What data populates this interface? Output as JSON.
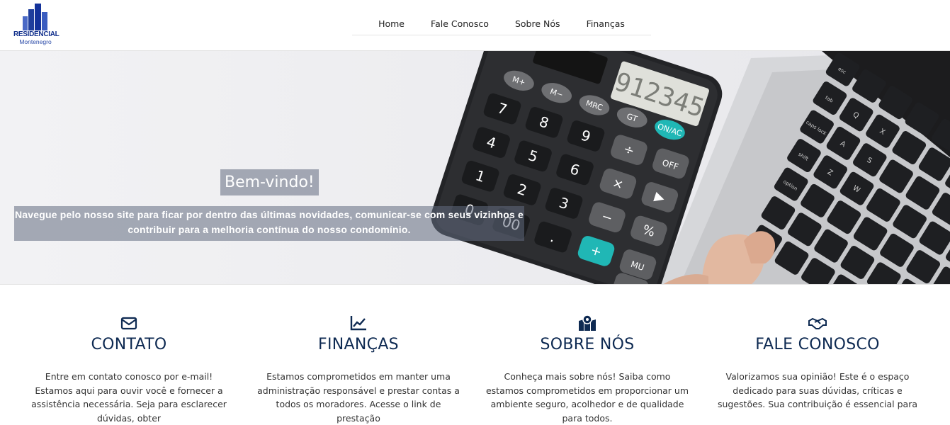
{
  "brand": {
    "name": "RESIDENCIAL",
    "subtitle": "Montenegro",
    "logo_color": "#1f3e9c"
  },
  "nav": {
    "items": [
      {
        "label": "Home"
      },
      {
        "label": "Fale Conosco"
      },
      {
        "label": "Sobre Nós"
      },
      {
        "label": "Finanças"
      }
    ]
  },
  "hero": {
    "title": "Bem-vindo!",
    "text": "Navegue pelo nosso site para ficar por dentro das últimas novidades, comunicar-se com seus vizinhos e contribuir para a melhoria contínua do nosso condomínio.",
    "calculator_display": "912345",
    "calculator_keys": {
      "row1": [
        "M+",
        "M−",
        "MRC",
        "GT",
        "ON/AC"
      ],
      "numbers": [
        "7",
        "8",
        "9",
        "4",
        "5",
        "6",
        "1",
        "2",
        "3",
        "0",
        "00",
        "."
      ],
      "ops": [
        "÷",
        "OFF",
        "×",
        "▶",
        "−",
        "%",
        "MU",
        "+",
        "="
      ]
    },
    "keyboard_keys": [
      "esc",
      "tab",
      "caps lock",
      "shift",
      "option",
      "Q",
      "A",
      "Z",
      "X",
      "S",
      "W"
    ]
  },
  "cards": [
    {
      "icon": "envelope-icon",
      "title": "CONTATO",
      "text": "Entre em contato conosco por e-mail! Estamos aqui para ouvir você e fornecer a assistência necessária. Seja para esclarecer dúvidas, obter"
    },
    {
      "icon": "chart-line-icon",
      "title": "FINANÇAS",
      "text": "Estamos comprometidos em manter uma administração responsável e prestar contas a todos os moradores. Acesse o link de prestação"
    },
    {
      "icon": "map-location-icon",
      "title": "SOBRE NÓS",
      "text": "Conheça mais sobre nós! Saiba como estamos comprometidos em proporcionar um ambiente seguro, acolhedor e de qualidade para todos."
    },
    {
      "icon": "handshake-icon",
      "title": "FALE CONOSCO",
      "text": "Valorizamos sua opinião! Este é o espaço dedicado para suas dúvidas, críticas e sugestões. Sua contribuição é essencial para"
    }
  ],
  "colors": {
    "heading": "#0e2a52",
    "overlay": "rgba(98,108,128,0.55)",
    "accent_key": "#20b7b5"
  }
}
